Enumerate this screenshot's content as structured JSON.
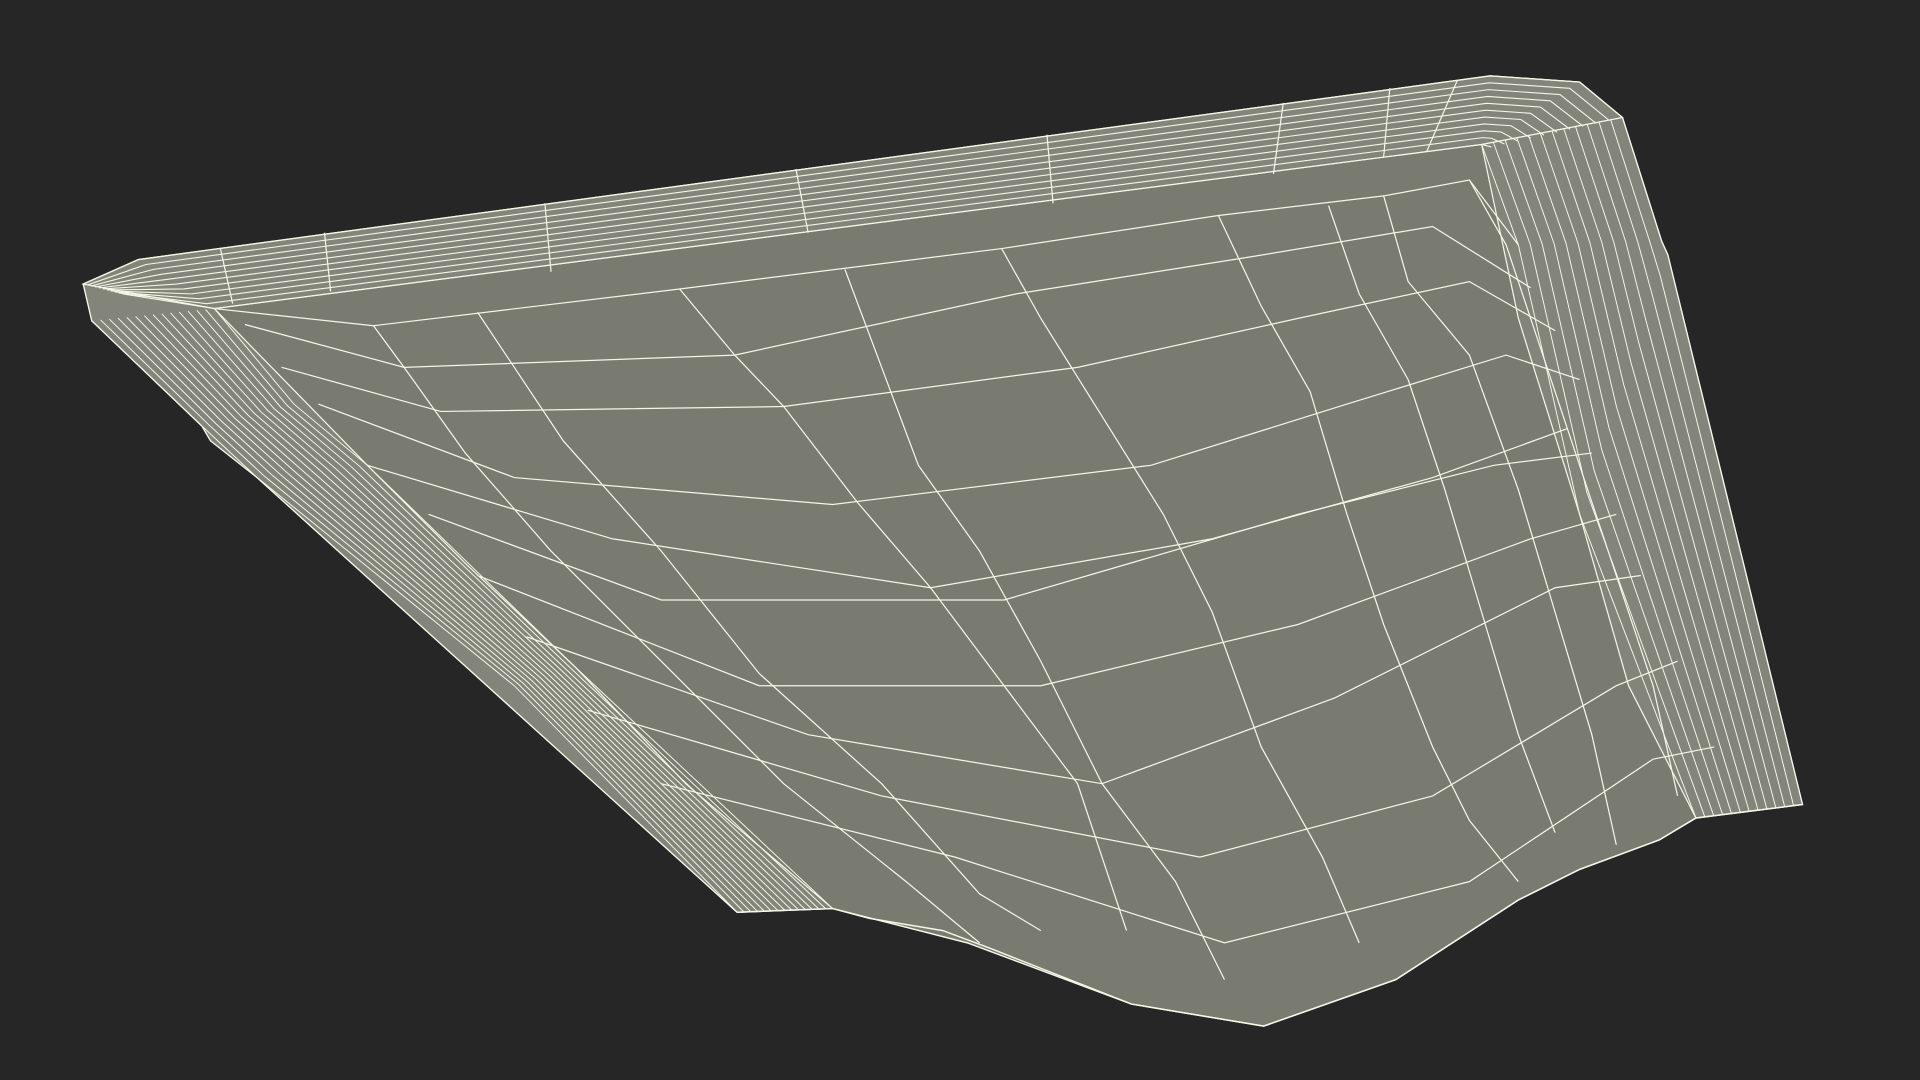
{
  "scene": {
    "background_color": "#262626",
    "mesh_fill_color": "#7a7b70",
    "mesh_face_color_light": "#83857a",
    "wire_color": "#f4f6e6",
    "object": "wireframe-mesh-shell"
  }
}
